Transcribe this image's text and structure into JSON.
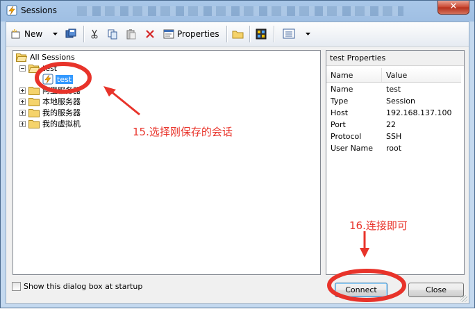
{
  "window": {
    "title": "Sessions",
    "close_glyph": "✕"
  },
  "toolbar": {
    "new_label": "New",
    "properties_label": "Properties",
    "icons": [
      "new-session-icon",
      "dropdown-arrow-icon",
      "save-icon",
      "cut-icon",
      "copy-icon",
      "paste-icon",
      "delete-icon",
      "properties-icon",
      "new-folder-icon",
      "shortcut-icon",
      "view-icon",
      "view-dropdown-arrow-icon"
    ]
  },
  "tree": {
    "root": "All Sessions",
    "folders": [
      {
        "label": "test",
        "expanded": true,
        "children": [
          {
            "label": "test",
            "selected": true
          }
        ]
      },
      {
        "label": "阿里服务器",
        "expanded": false
      },
      {
        "label": "本地服务器",
        "expanded": false
      },
      {
        "label": "我的服务器",
        "expanded": false
      },
      {
        "label": "我的虚拟机",
        "expanded": false
      }
    ]
  },
  "properties": {
    "title": "test Properties",
    "col_name": "Name",
    "col_value": "Value",
    "rows": [
      {
        "name": "Name",
        "value": "test"
      },
      {
        "name": "Type",
        "value": "Session"
      },
      {
        "name": "Host",
        "value": "192.168.137.100"
      },
      {
        "name": "Port",
        "value": "22"
      },
      {
        "name": "Protocol",
        "value": "SSH"
      },
      {
        "name": "User Name",
        "value": "root"
      }
    ]
  },
  "footer": {
    "checkbox_label": "Show this dialog box at startup",
    "checkbox_checked": false,
    "connect_label": "Connect",
    "close_label": "Close"
  },
  "annotations": {
    "step15": "15.选择刚保存的会话",
    "step16": "16.连接即可",
    "color": "#e8332a"
  }
}
